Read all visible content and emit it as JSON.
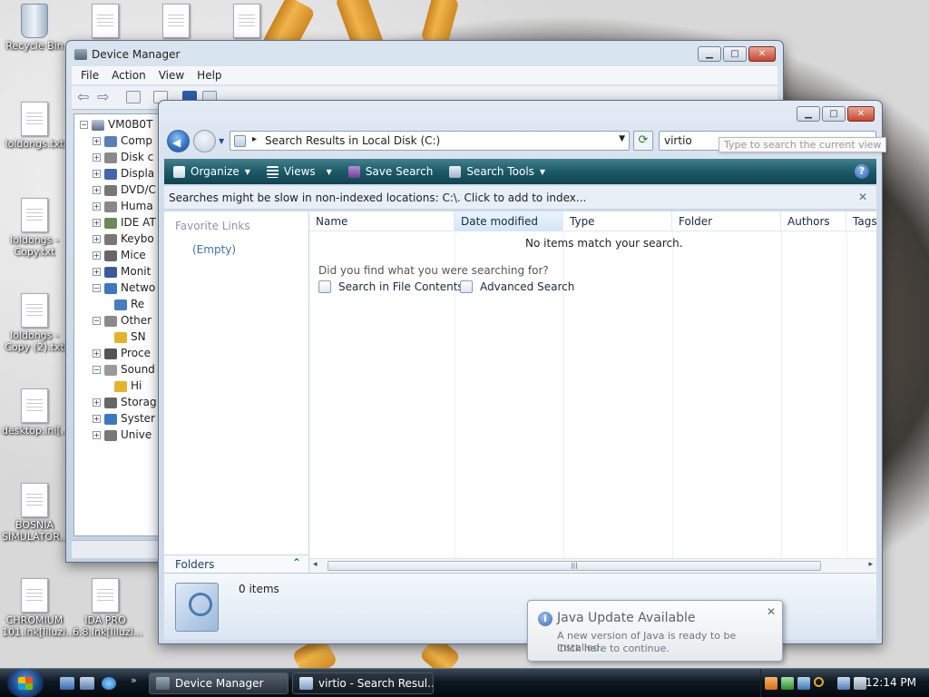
{
  "desktop": {
    "icons": [
      {
        "label": "Recycle Bin"
      },
      {
        "label": "loldongs.txt"
      },
      {
        "label": "loldongs - Copy.txt"
      },
      {
        "label": "loldongs - Copy (2).txt"
      },
      {
        "label": "desktop.ini[..."
      },
      {
        "label": "BOSNIA SIMULATOR..."
      },
      {
        "label": "CHROMIUM 101.lnk[liluzi..."
      },
      {
        "label": "IDA PRO 6.8.lnk[liluzi..."
      }
    ]
  },
  "device_manager": {
    "title": "Device Manager",
    "menu": [
      "File",
      "Action",
      "View",
      "Help"
    ],
    "tree_root": "VM0B0T",
    "tree_items": [
      {
        "label": "Comp",
        "expanded": false
      },
      {
        "label": "Disk c",
        "expanded": false
      },
      {
        "label": "Displa",
        "expanded": false
      },
      {
        "label": "DVD/C",
        "expanded": false
      },
      {
        "label": "Huma",
        "expanded": false
      },
      {
        "label": "IDE AT",
        "expanded": false
      },
      {
        "label": "Keybo",
        "expanded": false
      },
      {
        "label": "Mice",
        "expanded": false
      },
      {
        "label": "Monit",
        "expanded": false
      },
      {
        "label": "Netwo",
        "expanded": true
      },
      {
        "label": "Re",
        "child": true
      },
      {
        "label": "Other",
        "expanded": true
      },
      {
        "label": "SN",
        "child": true,
        "warning": true
      },
      {
        "label": "Proce",
        "expanded": false
      },
      {
        "label": "Sound",
        "expanded": true
      },
      {
        "label": "Hi",
        "child": true,
        "warning": true
      },
      {
        "label": "Storag",
        "expanded": false
      },
      {
        "label": "Syster",
        "expanded": false
      },
      {
        "label": "Unive",
        "expanded": false
      }
    ]
  },
  "search_window": {
    "address_path": "Search Results in Local Disk (C:)",
    "search_query": "virtio",
    "search_tooltip": "Type to search the current view",
    "commands": {
      "organize": "Organize",
      "views": "Views",
      "save_search": "Save Search",
      "search_tools": "Search Tools"
    },
    "infobar": "Searches might be slow in non-indexed locations: C:\\. Click to add to index...",
    "favorite_links_header": "Favorite Links",
    "favorite_links_empty": "(Empty)",
    "folders_label": "Folders",
    "columns": [
      "Name",
      "Date modified",
      "Type",
      "Folder",
      "Authors",
      "Tags"
    ],
    "sorted_column": "Date modified",
    "no_items": "No items match your search.",
    "did_you_find": "Did you find what you were searching for?",
    "search_in_contents": "Search in File Contents",
    "advanced_search": "Advanced Search",
    "item_count": "0 items"
  },
  "taskbar": {
    "buttons": [
      {
        "label": "Device Manager",
        "active": false
      },
      {
        "label": "virtio - Search Resul...",
        "active": true
      }
    ],
    "clock": "12:14 PM"
  },
  "notification": {
    "title": "Java Update Available",
    "message": "A new version of Java is ready to be installed.",
    "link": "Click here to continue."
  }
}
